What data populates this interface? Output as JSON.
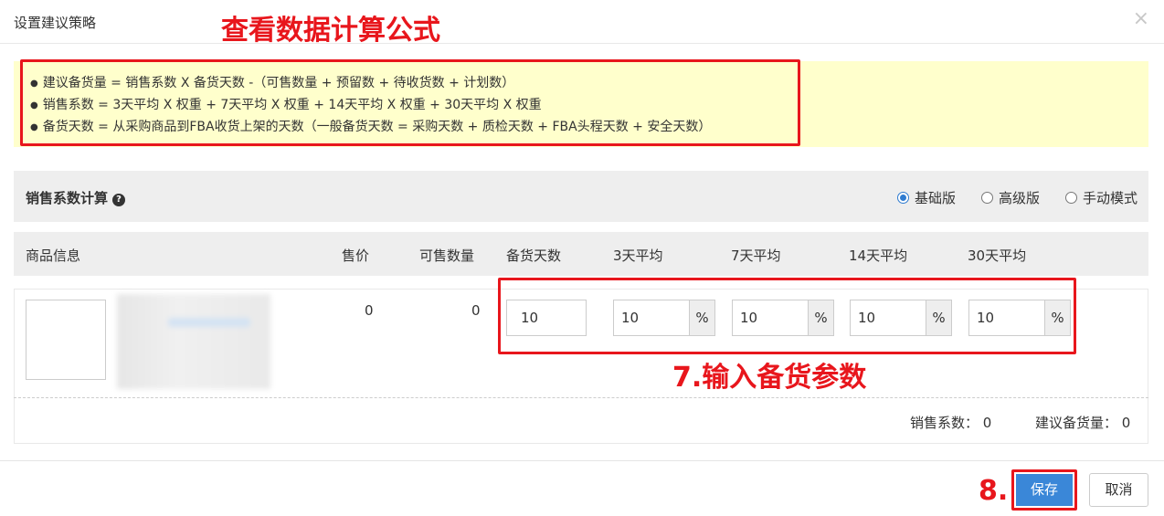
{
  "dialog": {
    "title": "设置建议策略",
    "close_icon": "×"
  },
  "annotations": {
    "view_formula": "查看数据计算公式",
    "step7": "7.输入备货参数",
    "step8": "8."
  },
  "formulas": [
    "建议备货量 = 销售系数 X 备货天数 -（可售数量 + 预留数 + 待收货数 + 计划数）",
    "销售系数 = 3天平均 X 权重 + 7天平均 X 权重 + 14天平均 X 权重 + 30天平均 X 权重",
    "备货天数 = 从采购商品到FBA收货上架的天数（一般备货天数 = 采购天数 + 质检天数 + FBA头程天数 + 安全天数）"
  ],
  "sales_section": {
    "title": "销售系数计算",
    "help_icon": "?",
    "modes": [
      {
        "label": "基础版",
        "checked": true
      },
      {
        "label": "高级版",
        "checked": false
      },
      {
        "label": "手动模式",
        "checked": false
      }
    ]
  },
  "table": {
    "headers": {
      "product": "商品信息",
      "price": "售价",
      "available": "可售数量",
      "stock_days": "备货天数",
      "avg3": "3天平均",
      "avg7": "7天平均",
      "avg14": "14天平均",
      "avg30": "30天平均"
    },
    "row": {
      "price": "0",
      "available": "0",
      "stock_days": "10",
      "avg3": "10",
      "avg7": "10",
      "avg14": "10",
      "avg30": "10",
      "percent": "%"
    }
  },
  "summary": {
    "sales_coef_label": "销售系数：",
    "sales_coef_value": "0",
    "suggest_label": "建议备货量：",
    "suggest_value": "0"
  },
  "buttons": {
    "save": "保存",
    "cancel": "取消"
  },
  "colors": {
    "annotation_red": "#e8161c",
    "primary_blue": "#3a87d8",
    "formula_bg": "#ffffcc"
  }
}
